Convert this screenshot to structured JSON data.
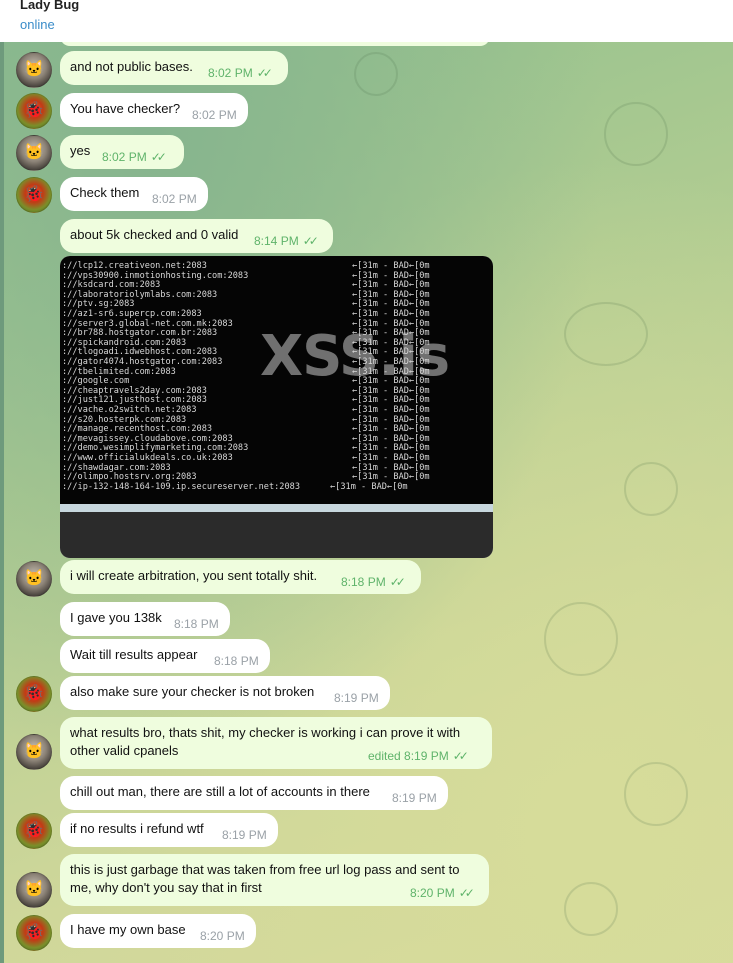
{
  "header": {
    "name": "Lady Bug",
    "status": "online"
  },
  "messages": [
    {
      "text": "and not public bases.",
      "time": "8:02 PM",
      "out": true,
      "read": true,
      "avatar": "cat"
    },
    {
      "text": "You have checker?",
      "time": "8:02 PM",
      "out": false,
      "avatar": "bug"
    },
    {
      "text": "yes",
      "time": "8:02 PM",
      "out": true,
      "read": true,
      "avatar": "cat"
    },
    {
      "text": "Check them",
      "time": "8:02 PM",
      "out": false,
      "avatar": "bug"
    },
    {
      "text": "about 5k checked and 0 valid",
      "time": "8:14 PM",
      "out": true,
      "read": true
    },
    {
      "text": "i will create arbitration, you sent totally shit.",
      "time": "8:18 PM",
      "out": true,
      "read": true,
      "avatar": "cat"
    },
    {
      "text": "I gave you 138k",
      "time": "8:18 PM",
      "out": false
    },
    {
      "text": "Wait till results appear",
      "time": "8:18 PM",
      "out": false
    },
    {
      "text": "also make sure your checker is not broken",
      "time": "8:19 PM",
      "out": false,
      "avatar": "bug"
    },
    {
      "text_line1": "what results bro, thats shit, my checker is working i can prove it with",
      "text_line2": "other valid cpanels",
      "time": "edited 8:19 PM",
      "out": true,
      "read": true,
      "avatar": "cat"
    },
    {
      "text": "chill out man, there are still a lot of accounts in there",
      "time": "8:19 PM",
      "out": false
    },
    {
      "text": "if no results i refund wtf",
      "time": "8:19 PM",
      "out": false,
      "avatar": "bug"
    },
    {
      "text_line1": "this is just garbage that was taken from free url log pass and sent to",
      "text_line2": "me, why don't you say that in first",
      "time": "8:20 PM",
      "out": true,
      "read": true,
      "avatar": "cat"
    },
    {
      "text": "I have my own base",
      "time": "8:20 PM",
      "out": false,
      "avatar": "bug"
    }
  ],
  "terminal": {
    "watermark": "XSS.is",
    "lines": [
      "://lcp12.creativeon.net:2083",
      "://vps30900.inmotionhosting.com:2083",
      "://ksdcard.com:2083",
      "://laboratoriolymlabs.com:2083",
      "://ptv.sg:2083",
      "://az1-sr6.supercp.com:2083",
      "://server3.global-net.com.mk:2083",
      "://br788.hostgator.com.br:2083",
      "://spickandroid.com:2083",
      "://tlogoadi.idwebhost.com:2083",
      "://gator4074.hostgator.com:2083",
      "://tbelimited.com:2083",
      "://google.com",
      "://cheaptravels2day.com:2083",
      "://just121.justhost.com:2083",
      "://vache.o2switch.net:2083",
      "://s20.hosterpk.com:2083",
      "://manage.recenthost.com:2083",
      "://mevagissey.cloudabove.com:2083",
      "://demo.wesimplifymarketing.com:2083",
      "://www.officialukdeals.co.uk:2083",
      "://shawdagar.com:2083",
      "://olimpo.hostsrv.org:2083",
      "://ip-132-148-164-109.ip.secureserver.net:2083"
    ],
    "result": "←[31m - BAD←[0m"
  }
}
